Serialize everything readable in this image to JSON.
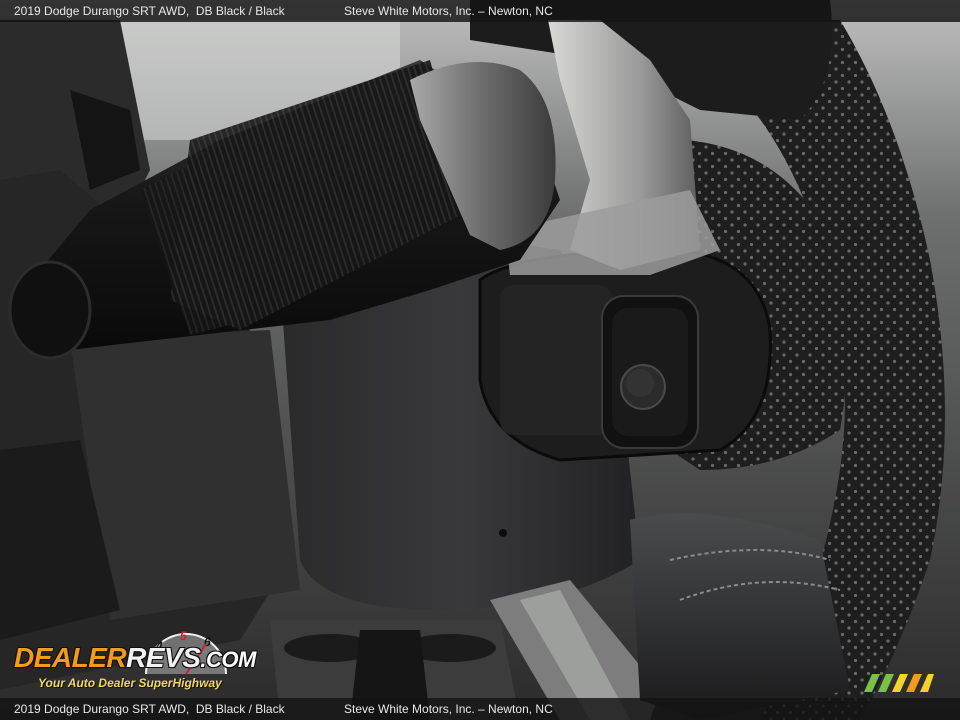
{
  "caption": {
    "vehicle": "2019 Dodge Durango SRT AWD,",
    "colors": "DB Black / Black",
    "dealer": "Steve White Motors, Inc. – Newton, NC"
  },
  "watermark": {
    "brand": "DealerRevs.com",
    "tagline": "Your Auto Dealer SuperHighway",
    "dial_numbers": [
      "4",
      "5",
      "6"
    ]
  },
  "colors": {
    "accent_orange": "#f39b1c",
    "accent_yellow": "#f1d66a",
    "stripe_green": "#7ac142",
    "stripe_yellow": "#f6d12e",
    "stripe_orange": "#f39b1c"
  }
}
